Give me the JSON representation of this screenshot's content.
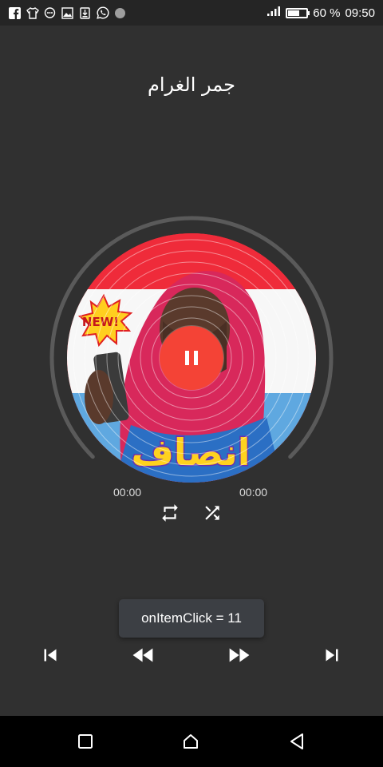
{
  "status_bar": {
    "icons": [
      "facebook-icon",
      "shirt-icon",
      "message-icon",
      "image-icon",
      "download-icon",
      "whatsapp-icon",
      "dot-icon"
    ],
    "signal_icon": "signal-icon",
    "battery_level": 0.6,
    "battery_text": "60 %",
    "time": "09:50"
  },
  "player": {
    "title": "جمر الغرام",
    "cover_badge": "NEW!",
    "cover_text": "انصاف",
    "progress": 0.0,
    "elapsed": "00:00",
    "total": "00:00",
    "state": "playing",
    "accent_color": "#f44336",
    "ring_color": "#5a5a5a"
  },
  "controls": {
    "repeat_icon": "repeat-icon",
    "shuffle_icon": "shuffle-icon",
    "prev_icon": "skip-previous-icon",
    "rewind_icon": "rewind-icon",
    "forward_icon": "fast-forward-icon",
    "next_icon": "skip-next-icon"
  },
  "toast": {
    "text": "onItemClick = 11"
  },
  "nav_bar": {
    "recent_icon": "recent-apps-icon",
    "home_icon": "home-icon",
    "back_icon": "back-icon"
  }
}
